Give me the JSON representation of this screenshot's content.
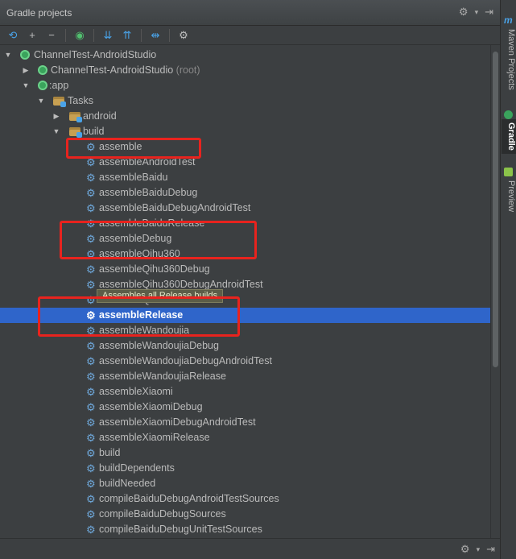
{
  "window": {
    "title": "Gradle projects"
  },
  "side_tabs": [
    {
      "label": "Maven Projects",
      "active": false
    },
    {
      "label": "Gradle",
      "active": true
    },
    {
      "label": "Preview",
      "active": false
    }
  ],
  "side_logo": "m",
  "titlebar_icons": [
    "gear-icon",
    "dropdown-icon",
    "pin-icon"
  ],
  "toolbar_icons": [
    "refresh-icon",
    "add-icon",
    "remove-icon",
    "gradle-run-icon",
    "expand-all-icon",
    "collapse-all-icon",
    "link-icon",
    "settings-icon"
  ],
  "tooltip": "Assembles all Release builds",
  "colors": {
    "selection": "#2f65ca",
    "annotation": "#e8231e",
    "background": "#3c3f41"
  },
  "tree": {
    "root": {
      "label": "ChannelTest-AndroidStudio"
    },
    "root_project": {
      "label": "ChannelTest-AndroidStudio",
      "suffix": "(root)"
    },
    "module": {
      "label": ":app"
    },
    "tasks_folder": {
      "label": "Tasks"
    },
    "android_group": {
      "label": "android"
    },
    "build_group": {
      "label": "build"
    },
    "build_tasks": [
      "assemble",
      "assembleAndroidTest",
      "assembleBaidu",
      "assembleBaiduDebug",
      "assembleBaiduDebugAndroidTest",
      "assembleBaiduRelease",
      "assembleDebug",
      "assembleQihu360",
      "assembleQihu360Debug",
      "assembleQihu360DebugAndroidTest",
      "assembleQihu360Release",
      "assembleRelease",
      "assembleWandoujia",
      "assembleWandoujiaDebug",
      "assembleWandoujiaDebugAndroidTest",
      "assembleWandoujiaRelease",
      "assembleXiaomi",
      "assembleXiaomiDebug",
      "assembleXiaomiDebugAndroidTest",
      "assembleXiaomiRelease",
      "build",
      "buildDependents",
      "buildNeeded",
      "compileBaiduDebugAndroidTestSources",
      "compileBaiduDebugSources",
      "compileBaiduDebugUnitTestSources"
    ],
    "selected_task": "assembleRelease"
  }
}
